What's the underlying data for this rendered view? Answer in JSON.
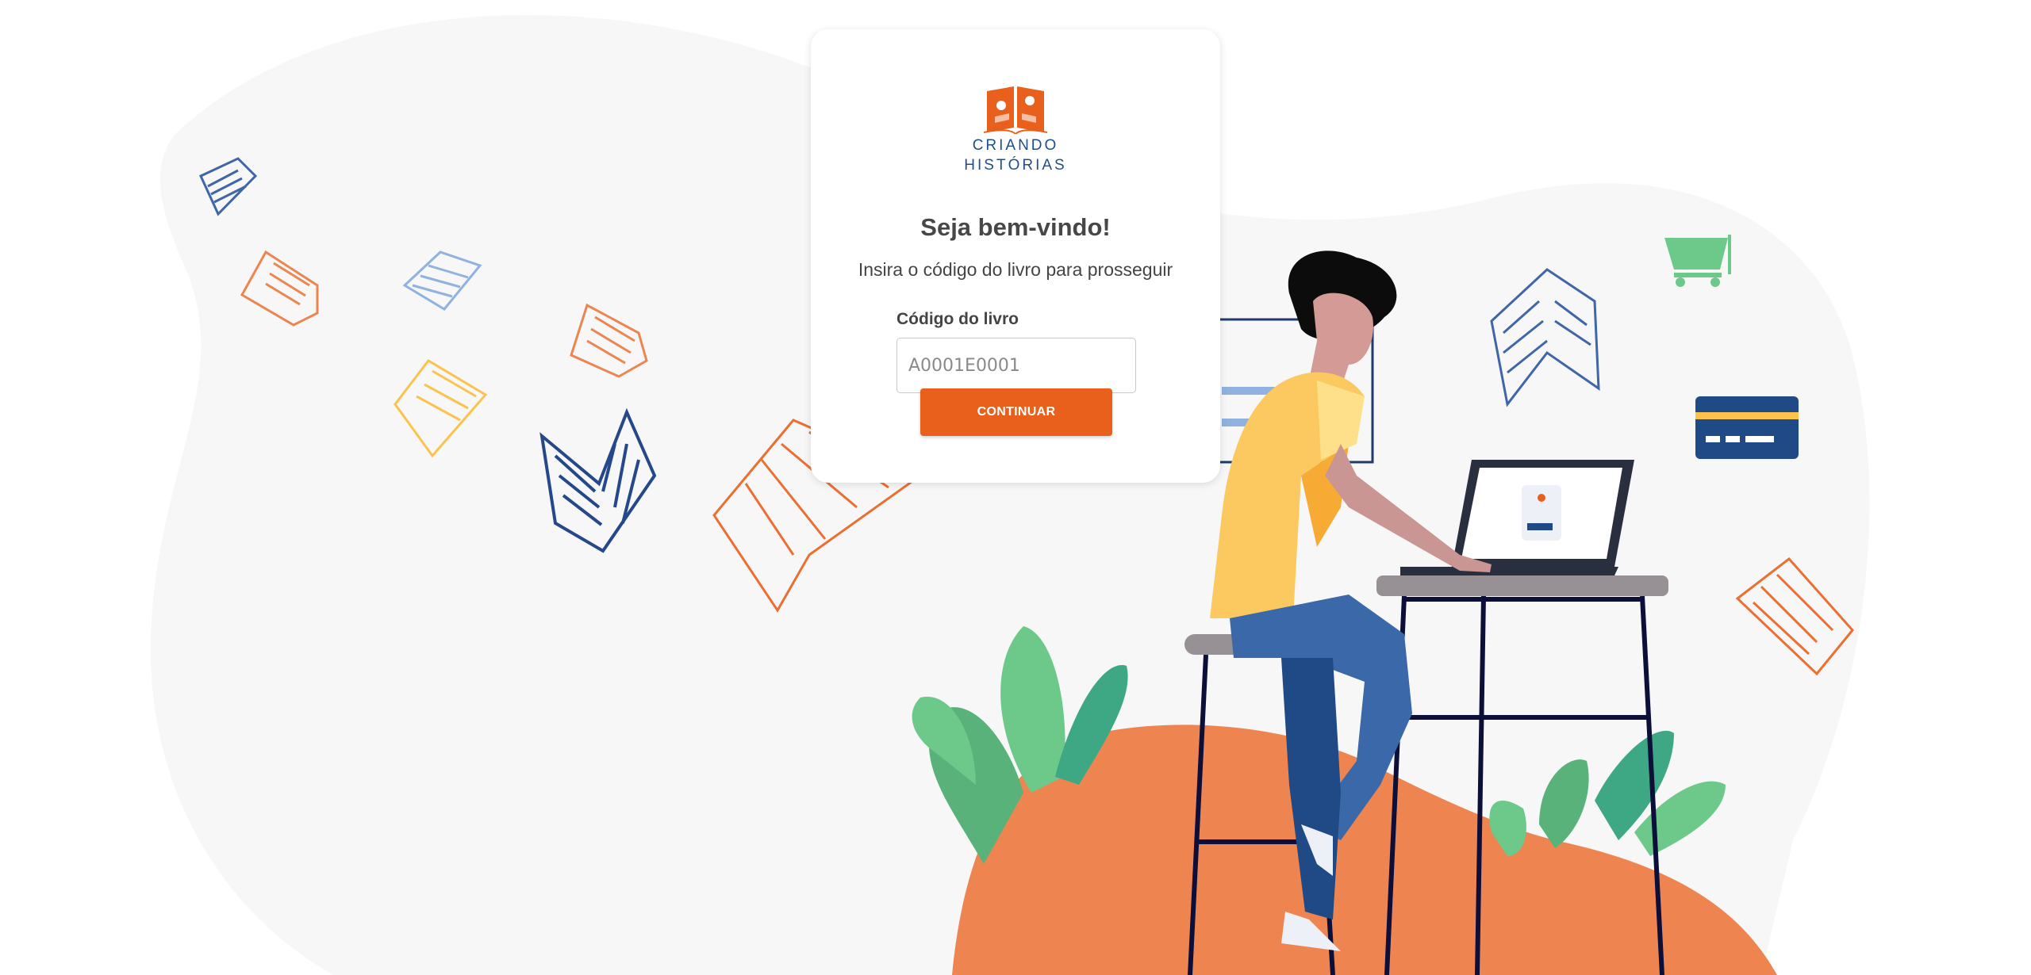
{
  "brand": {
    "name_line1": "CRIANDO",
    "name_line2": "HISTÓRIAS",
    "logo_icon": "open-book-puzzle-icon"
  },
  "login": {
    "title": "Seja bem-vindo!",
    "subtitle": "Insira o código do livro para prosseguir",
    "code_label": "Código do livro",
    "code_placeholder": "A0001E0001",
    "code_value": "",
    "continue_label": "CONTINUAR"
  },
  "illustration": {
    "description_icons": [
      "book-icon",
      "shopping-cart-icon",
      "credit-card-icon",
      "laptop-icon",
      "person-icon",
      "plant-icon"
    ]
  },
  "colors": {
    "accent_orange": "#e8601b",
    "brand_blue": "#1f4e8a",
    "blob_orange": "#ee8550",
    "background_blob": "#f7f7f7",
    "cart_green": "#6cc98a",
    "card_blue": "#1f4a86",
    "shirt_yellow": "#fcc960",
    "jeans_blue": "#3a68a8"
  }
}
